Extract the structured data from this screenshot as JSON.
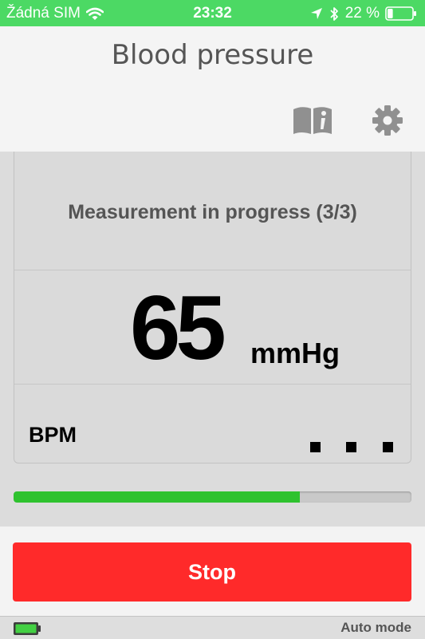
{
  "status_bar": {
    "carrier": "Žádná SIM",
    "time": "23:32",
    "battery_percent": "22 %",
    "battery_level": 0.22,
    "icons": [
      "wifi-icon",
      "location-arrow-icon",
      "bluetooth-icon",
      "battery-icon"
    ]
  },
  "header": {
    "title": "Blood pressure"
  },
  "toolbar": {
    "icons": [
      "book-info-icon",
      "gear-icon"
    ]
  },
  "measurement": {
    "status_message": "Measurement in progress (3/3)",
    "pressure_value": "65",
    "pressure_unit": "mmHg",
    "bpm_label": "BPM",
    "progress": 0.72
  },
  "actions": {
    "stop_label": "Stop"
  },
  "footer": {
    "mode_label": "Auto mode",
    "device_battery_icon": "battery-full-icon"
  },
  "colors": {
    "status_bar": "#4cd964",
    "stop_button": "#ff2a2a",
    "progress_fill": "#2ec22e"
  }
}
